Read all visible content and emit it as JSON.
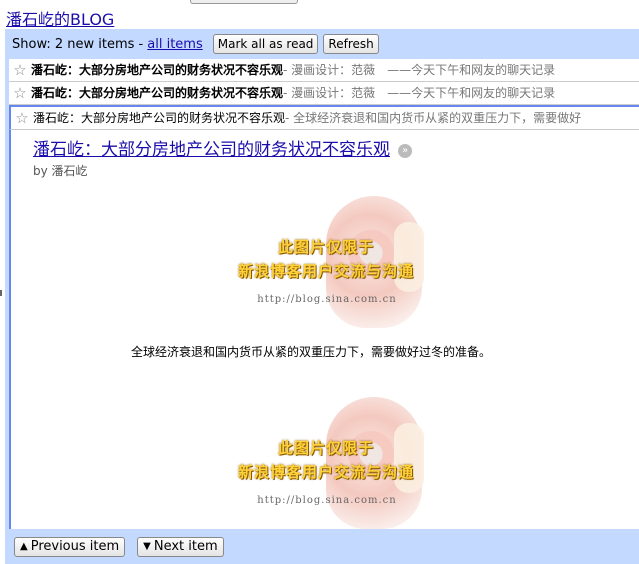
{
  "feed": {
    "title": "潘石屹的BLOG"
  },
  "toolbar": {
    "show_prefix": "Show: 2 new items -",
    "all_items_label": "all items",
    "mark_all_read_label": "Mark all as read",
    "refresh_label": "Refresh"
  },
  "entries": [
    {
      "title": "潘石屹：大部分房地产公司的财务状况不容乐观",
      "snippet": " - 漫画设计：范薇　——今天下午和网友的聊天记录",
      "starred": false
    },
    {
      "title": "潘石屹：大部分房地产公司的财务状况不容乐观",
      "snippet": " - 漫画设计：范薇　——今天下午和网友的聊天记录",
      "starred": false
    },
    {
      "title": "潘石屹：大部分房地产公司的财务状况不容乐观",
      "snippet": " - 全球经济衰退和国内货币从紧的双重压力下，需要做好",
      "starred": false
    }
  ],
  "expanded_entry": {
    "title": "潘石屹：大部分房地产公司的财务状况不容乐观",
    "byline": "by 潘石屹",
    "paragraph": "全球经济衰退和国内货币从紧的双重压力下，需要做好过冬的准备。",
    "image_watermark": {
      "line1": "此图片仅限于",
      "line2": "新浪博客用户交流与沟通",
      "url": "http://blog.sina.com.cn"
    }
  },
  "icons": {
    "star": "star-outline-icon",
    "open": "open-arrow-icon",
    "prev": "triangle-up-icon",
    "next": "triangle-down-icon"
  },
  "bottom": {
    "prev_label": "Previous item",
    "next_label": "Next item"
  },
  "colors": {
    "link": "#1a0dab",
    "viewer_bg": "#c3d9ff",
    "selection_border": "#6688ee"
  }
}
